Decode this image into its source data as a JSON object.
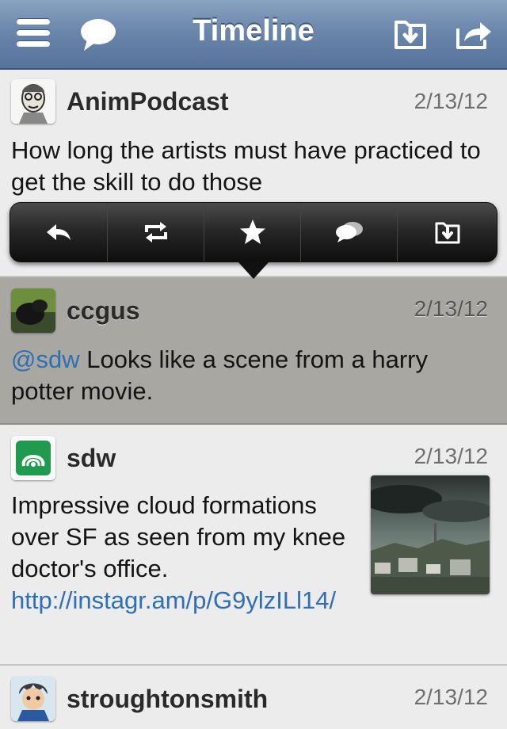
{
  "nav": {
    "title": "Timeline",
    "icons": [
      "menu-icon",
      "bubble-icon",
      "save-icon",
      "share-icon"
    ]
  },
  "tweets": [
    {
      "username": "AnimPodcast",
      "date": "2/13/12",
      "text": "How long the artists must have practiced to get the skill to do those"
    },
    {
      "username": "ccgus",
      "date": "2/13/12",
      "mention": "@sdw",
      "text": " Looks like a scene from a harry potter movie."
    },
    {
      "username": "sdw",
      "date": "2/13/12",
      "text": "Impressive cloud formations over SF as seen from my knee doctor's office. ",
      "link": "http://instagr.am/p/G9ylzILl14/"
    },
    {
      "username": "stroughtonsmith",
      "date": "2/13/12"
    }
  ],
  "action_bar": {
    "icons": [
      "reply-icon",
      "retweet-icon",
      "star-icon",
      "conversation-icon",
      "save-icon"
    ]
  },
  "colors": {
    "navbar": "#6a86ab",
    "link": "#2f6fb5",
    "selected_row": "#a9a7a2"
  }
}
